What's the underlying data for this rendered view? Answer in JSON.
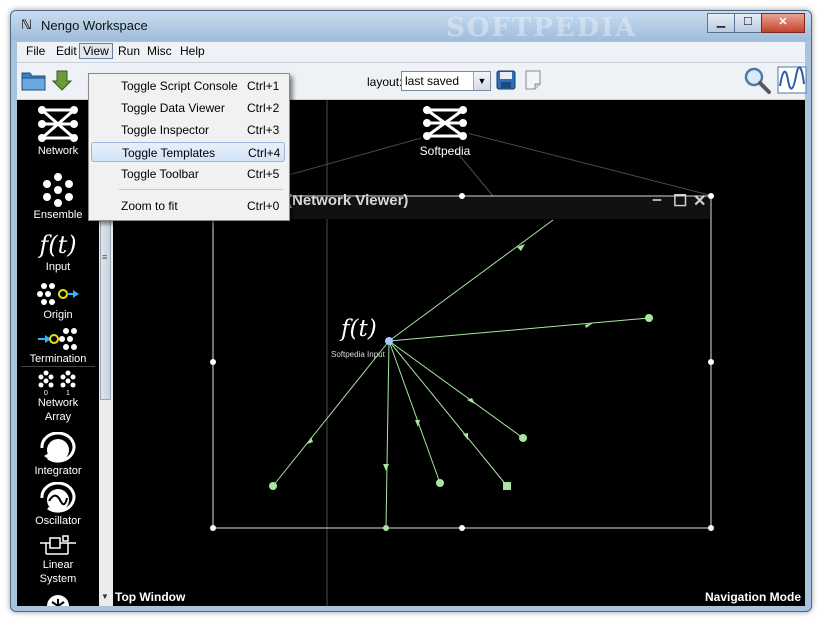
{
  "window": {
    "title": "Nengo Workspace",
    "watermark": "SOFTPEDIA",
    "controls": {
      "minimize": "▁",
      "maximize": "☐",
      "close": "✕"
    }
  },
  "menubar": [
    "File",
    "Edit",
    "View",
    "Run",
    "Misc",
    "Help"
  ],
  "toolbar": {
    "layout_label": "layout:",
    "layout_value": "last saved"
  },
  "view_menu": [
    {
      "label": "Toggle Script Console",
      "shortcut": "Ctrl+1"
    },
    {
      "label": "Toggle Data Viewer",
      "shortcut": "Ctrl+2"
    },
    {
      "label": "Toggle Inspector",
      "shortcut": "Ctrl+3"
    },
    {
      "label": "Toggle Templates",
      "shortcut": "Ctrl+4"
    },
    {
      "label": "Toggle Toolbar",
      "shortcut": "Ctrl+5"
    },
    {
      "label": "Zoom to fit",
      "shortcut": "Ctrl+0"
    }
  ],
  "palette": {
    "network": "Network",
    "ensemble": "Ensemble",
    "input_glyph": "f(t)",
    "input": "Input",
    "origin": "Origin",
    "termination": "Termination",
    "network_array_1": "Network",
    "network_array_2": "Array",
    "integrator": "Integrator",
    "oscillator": "Oscillator",
    "linear_1": "Linear",
    "linear_2": "System"
  },
  "canvas": {
    "top_node_label": "Softpedia",
    "viewer_title": "(Network Viewer)",
    "input_glyph": "f(t)",
    "input_label": "Softpedia Input",
    "status_left": "Top Window",
    "status_right": "Navigation Mode"
  },
  "colors": {
    "edge": "#a8e6a0",
    "node": "#a8e6a0",
    "input_node": "#a6c8ff",
    "canvas_bg": "#000000"
  }
}
